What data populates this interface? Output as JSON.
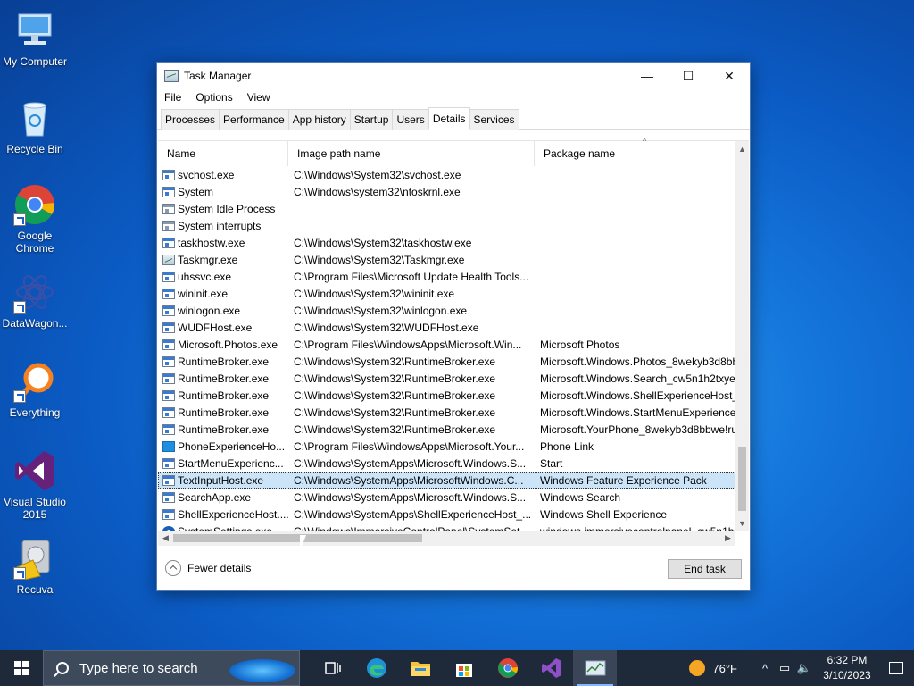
{
  "desktop": {
    "icons": [
      {
        "label": "My Computer",
        "icon": "monitor-icon"
      },
      {
        "label": "Recycle Bin",
        "icon": "recycle-bin-icon"
      },
      {
        "label": "Google Chrome",
        "icon": "chrome-icon"
      },
      {
        "label": "DataWagon...",
        "icon": "datawagon-icon"
      },
      {
        "label": "Everything",
        "icon": "everything-search-icon"
      },
      {
        "label": "Visual Studio 2015",
        "icon": "visual-studio-icon"
      },
      {
        "label": "Recuva",
        "icon": "recuva-icon"
      }
    ]
  },
  "window": {
    "title": "Task Manager",
    "controls": {
      "minimize": "—",
      "maximize": "☐",
      "close": "✕"
    },
    "menu": [
      "File",
      "Options",
      "View"
    ],
    "tabs": [
      "Processes",
      "Performance",
      "App history",
      "Startup",
      "Users",
      "Details",
      "Services"
    ],
    "active_tab": "Details",
    "columns": [
      "Name",
      "Image path name",
      "Package name"
    ],
    "sort_indicator": "^",
    "rows": [
      {
        "name": "svchost.exe",
        "path": "C:\\Windows\\System32\\svchost.exe",
        "package": "",
        "icon": "window-icon"
      },
      {
        "name": "System",
        "path": "C:\\Windows\\system32\\ntoskrnl.exe",
        "package": "",
        "icon": "window-icon"
      },
      {
        "name": "System Idle Process",
        "path": "",
        "package": "",
        "icon": "window-gray-icon"
      },
      {
        "name": "System interrupts",
        "path": "",
        "package": "",
        "icon": "window-gray-icon"
      },
      {
        "name": "taskhostw.exe",
        "path": "C:\\Windows\\System32\\taskhostw.exe",
        "package": "",
        "icon": "window-icon"
      },
      {
        "name": "Taskmgr.exe",
        "path": "C:\\Windows\\System32\\Taskmgr.exe",
        "package": "",
        "icon": "task-manager-icon"
      },
      {
        "name": "uhssvc.exe",
        "path": "C:\\Program Files\\Microsoft Update Health Tools...",
        "package": "",
        "icon": "window-icon"
      },
      {
        "name": "wininit.exe",
        "path": "C:\\Windows\\System32\\wininit.exe",
        "package": "",
        "icon": "window-icon"
      },
      {
        "name": "winlogon.exe",
        "path": "C:\\Windows\\System32\\winlogon.exe",
        "package": "",
        "icon": "window-icon"
      },
      {
        "name": "WUDFHost.exe",
        "path": "C:\\Windows\\System32\\WUDFHost.exe",
        "package": "",
        "icon": "window-icon"
      },
      {
        "name": "Microsoft.Photos.exe",
        "path": "C:\\Program Files\\WindowsApps\\Microsoft.Win...",
        "package": "Microsoft Photos",
        "icon": "window-icon"
      },
      {
        "name": "RuntimeBroker.exe",
        "path": "C:\\Windows\\System32\\RuntimeBroker.exe",
        "package": "Microsoft.Windows.Photos_8wekyb3d8bb",
        "icon": "window-icon"
      },
      {
        "name": "RuntimeBroker.exe",
        "path": "C:\\Windows\\System32\\RuntimeBroker.exe",
        "package": "Microsoft.Windows.Search_cw5n1h2txyew",
        "icon": "window-icon"
      },
      {
        "name": "RuntimeBroker.exe",
        "path": "C:\\Windows\\System32\\RuntimeBroker.exe",
        "package": "Microsoft.Windows.ShellExperienceHost_",
        "icon": "window-icon"
      },
      {
        "name": "RuntimeBroker.exe",
        "path": "C:\\Windows\\System32\\RuntimeBroker.exe",
        "package": "Microsoft.Windows.StartMenuExperience",
        "icon": "window-icon"
      },
      {
        "name": "RuntimeBroker.exe",
        "path": "C:\\Windows\\System32\\RuntimeBroker.exe",
        "package": "Microsoft.YourPhone_8wekyb3d8bbwe!ru",
        "icon": "window-icon"
      },
      {
        "name": "PhoneExperienceHo...",
        "path": "C:\\Program Files\\WindowsApps\\Microsoft.Your...",
        "package": "Phone Link",
        "icon": "phone-link-icon"
      },
      {
        "name": "StartMenuExperienc...",
        "path": "C:\\Windows\\SystemApps\\Microsoft.Windows.S...",
        "package": "Start",
        "icon": "window-icon"
      },
      {
        "name": "TextInputHost.exe",
        "path": "C:\\Windows\\SystemApps\\MicrosoftWindows.C...",
        "package": "Windows Feature Experience Pack",
        "icon": "window-icon",
        "selected": true
      },
      {
        "name": "SearchApp.exe",
        "path": "C:\\Windows\\SystemApps\\Microsoft.Windows.S...",
        "package": "Windows Search",
        "icon": "window-icon"
      },
      {
        "name": "ShellExperienceHost....",
        "path": "C:\\Windows\\SystemApps\\ShellExperienceHost_...",
        "package": "Windows Shell Experience",
        "icon": "window-icon"
      },
      {
        "name": "SystemSettings.exe",
        "path": "C:\\Windows\\ImmersiveControlPanel\\SystemSet...",
        "package": "windows.immersivecontrolpanel_cw5n1h",
        "icon": "settings-gear-icon"
      }
    ],
    "footer": {
      "fewer_details": "Fewer details",
      "end_task": "End task"
    }
  },
  "taskbar": {
    "search_placeholder": "Type here to search",
    "pinned": [
      "task-view-icon",
      "edge-icon",
      "file-explorer-icon",
      "store-icon",
      "chrome-icon",
      "visual-studio-icon",
      "task-manager-icon"
    ],
    "temperature": "76°F",
    "time": "6:32 PM",
    "date": "3/10/2023"
  }
}
